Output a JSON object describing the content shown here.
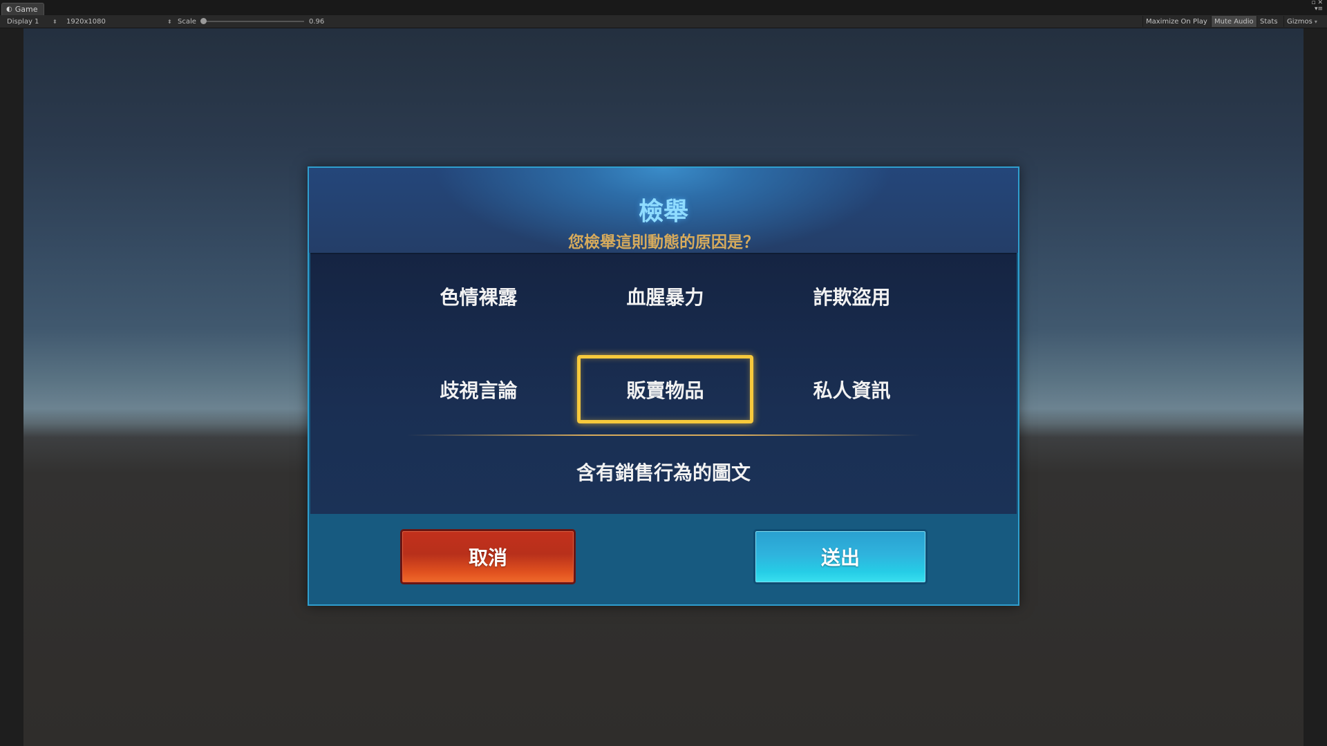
{
  "editor": {
    "tab_label": "Game",
    "tab_icon": "game-controller-icon",
    "display": "Display 1",
    "resolution": "1920x1080",
    "scale_label": "Scale",
    "scale_value": "0.96",
    "buttons": {
      "maximize": "Maximize On Play",
      "mute": "Mute Audio",
      "stats": "Stats",
      "gizmos": "Gizmos"
    }
  },
  "dialog": {
    "title": "檢舉",
    "subtitle": "您檢舉這則動態的原因是？",
    "options": [
      {
        "label": "色情裸露",
        "selected": false
      },
      {
        "label": "血腥暴力",
        "selected": false
      },
      {
        "label": "詐欺盜用",
        "selected": false
      },
      {
        "label": "歧視言論",
        "selected": false
      },
      {
        "label": "販賣物品",
        "selected": true
      },
      {
        "label": "私人資訊",
        "selected": false
      }
    ],
    "description": "含有銷售行為的圖文",
    "cancel_label": "取消",
    "submit_label": "送出"
  },
  "colors": {
    "title": "#8fdcff",
    "subtitle": "#d7ab5c",
    "selected_border": "#f7c93c",
    "cancel_button": "#c2301c",
    "submit_button": "#2fb3dd"
  }
}
